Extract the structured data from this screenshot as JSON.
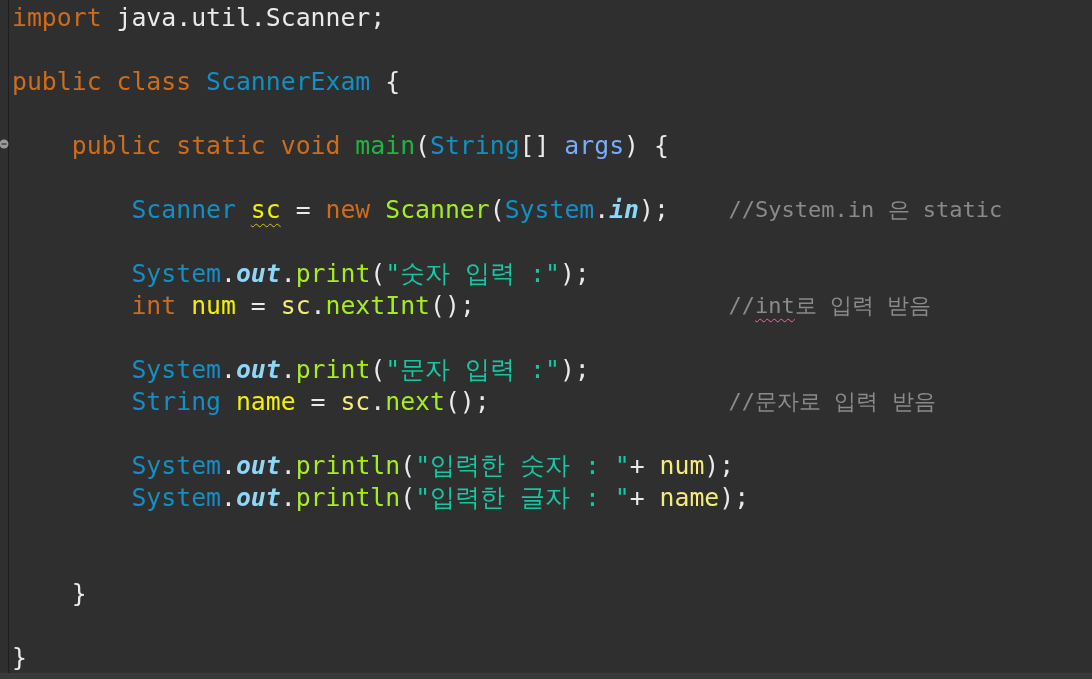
{
  "editor": {
    "lines": [
      {
        "kind": "code",
        "tokens": [
          {
            "text": "import",
            "kind": "keyword"
          },
          {
            "text": "java.util.Scanner;",
            "kind": "plain",
            "space_before": true
          }
        ]
      },
      {
        "kind": "blank"
      },
      {
        "kind": "code",
        "tokens": [
          {
            "text": "public",
            "kind": "keyword"
          },
          {
            "text": "class",
            "kind": "keyword",
            "space_before": true
          },
          {
            "text": "ScannerExam",
            "kind": "type",
            "space_before": true
          },
          {
            "text": "{",
            "kind": "plain",
            "space_before": true
          }
        ],
        "children": [
          {
            "kind": "blank"
          },
          {
            "kind": "code",
            "fold": true,
            "tokens": [
              {
                "text": "public",
                "kind": "keyword"
              },
              {
                "text": "static",
                "kind": "keyword",
                "space_before": true
              },
              {
                "text": "void",
                "kind": "keyword",
                "space_before": true
              },
              {
                "text": "main",
                "kind": "method-decl",
                "space_before": true
              },
              {
                "text": "(",
                "kind": "plain"
              },
              {
                "text": "String",
                "kind": "type"
              },
              {
                "text": "[]",
                "kind": "plain"
              },
              {
                "text": "args",
                "kind": "param",
                "space_before": true
              },
              {
                "text": ")",
                "kind": "plain"
              },
              {
                "text": "{",
                "kind": "plain",
                "space_before": true
              }
            ],
            "children": [
              {
                "kind": "blank"
              },
              {
                "kind": "code",
                "tokens": [
                  {
                    "text": "Scanner",
                    "kind": "type"
                  },
                  {
                    "text": "sc",
                    "kind": "local-decl",
                    "warning": true,
                    "space_before": true
                  },
                  {
                    "text": "=",
                    "kind": "plain",
                    "space_before": true
                  },
                  {
                    "text": "new",
                    "kind": "keyword",
                    "space_before": true
                  },
                  {
                    "text": "Scanner",
                    "kind": "method",
                    "space_before": true
                  },
                  {
                    "text": "(",
                    "kind": "plain"
                  },
                  {
                    "text": "System",
                    "kind": "type"
                  },
                  {
                    "text": ".",
                    "kind": "plain"
                  },
                  {
                    "text": "in",
                    "kind": "field"
                  },
                  {
                    "text": ");",
                    "kind": "plain"
                  }
                ],
                "comment": [
                  {
                    "text": "//System.in 은 static"
                  }
                ]
              },
              {
                "kind": "blank"
              },
              {
                "kind": "code",
                "tokens": [
                  {
                    "text": "System",
                    "kind": "type"
                  },
                  {
                    "text": ".",
                    "kind": "plain"
                  },
                  {
                    "text": "out",
                    "kind": "field"
                  },
                  {
                    "text": ".",
                    "kind": "plain"
                  },
                  {
                    "text": "print",
                    "kind": "method"
                  },
                  {
                    "text": "(",
                    "kind": "plain"
                  },
                  {
                    "text": "\"숫자 입력 :\"",
                    "kind": "string"
                  },
                  {
                    "text": ");",
                    "kind": "plain"
                  }
                ]
              },
              {
                "kind": "code",
                "tokens": [
                  {
                    "text": "int",
                    "kind": "keyword"
                  },
                  {
                    "text": "num",
                    "kind": "local-decl",
                    "space_before": true
                  },
                  {
                    "text": "=",
                    "kind": "plain",
                    "space_before": true
                  },
                  {
                    "text": "sc",
                    "kind": "local",
                    "space_before": true
                  },
                  {
                    "text": ".",
                    "kind": "plain"
                  },
                  {
                    "text": "nextInt",
                    "kind": "method"
                  },
                  {
                    "text": "();",
                    "kind": "plain"
                  }
                ],
                "comment": [
                  {
                    "text": "//"
                  },
                  {
                    "text": "int",
                    "misspelled": true
                  },
                  {
                    "text": "로 입력 받음"
                  }
                ]
              },
              {
                "kind": "blank"
              },
              {
                "kind": "code",
                "tokens": [
                  {
                    "text": "System",
                    "kind": "type"
                  },
                  {
                    "text": ".",
                    "kind": "plain"
                  },
                  {
                    "text": "out",
                    "kind": "field"
                  },
                  {
                    "text": ".",
                    "kind": "plain"
                  },
                  {
                    "text": "print",
                    "kind": "method"
                  },
                  {
                    "text": "(",
                    "kind": "plain"
                  },
                  {
                    "text": "\"문자 입력 :\"",
                    "kind": "string"
                  },
                  {
                    "text": ");",
                    "kind": "plain"
                  }
                ]
              },
              {
                "kind": "code",
                "tokens": [
                  {
                    "text": "String",
                    "kind": "type"
                  },
                  {
                    "text": "name",
                    "kind": "local-decl",
                    "space_before": true
                  },
                  {
                    "text": "=",
                    "kind": "plain",
                    "space_before": true
                  },
                  {
                    "text": "sc",
                    "kind": "local",
                    "space_before": true
                  },
                  {
                    "text": ".",
                    "kind": "plain"
                  },
                  {
                    "text": "next",
                    "kind": "method"
                  },
                  {
                    "text": "();",
                    "kind": "plain"
                  }
                ],
                "comment": [
                  {
                    "text": "//문자로 입력 받음"
                  }
                ]
              },
              {
                "kind": "blank"
              },
              {
                "kind": "code",
                "tokens": [
                  {
                    "text": "System",
                    "kind": "type"
                  },
                  {
                    "text": ".",
                    "kind": "plain"
                  },
                  {
                    "text": "out",
                    "kind": "field"
                  },
                  {
                    "text": ".",
                    "kind": "plain"
                  },
                  {
                    "text": "println",
                    "kind": "method"
                  },
                  {
                    "text": "(",
                    "kind": "plain"
                  },
                  {
                    "text": "\"입력한 숫자 : \"",
                    "kind": "string"
                  },
                  {
                    "text": "+",
                    "kind": "plain"
                  },
                  {
                    "text": "num",
                    "kind": "local",
                    "space_before": true
                  },
                  {
                    "text": ");",
                    "kind": "plain"
                  }
                ]
              },
              {
                "kind": "code",
                "tokens": [
                  {
                    "text": "System",
                    "kind": "type"
                  },
                  {
                    "text": ".",
                    "kind": "plain"
                  },
                  {
                    "text": "out",
                    "kind": "field"
                  },
                  {
                    "text": ".",
                    "kind": "plain"
                  },
                  {
                    "text": "println",
                    "kind": "method"
                  },
                  {
                    "text": "(",
                    "kind": "plain"
                  },
                  {
                    "text": "\"입력한 글자 : \"",
                    "kind": "string"
                  },
                  {
                    "text": "+",
                    "kind": "plain"
                  },
                  {
                    "text": "name",
                    "kind": "local",
                    "space_before": true
                  },
                  {
                    "text": ");",
                    "kind": "plain"
                  }
                ]
              },
              {
                "kind": "blank"
              },
              {
                "kind": "blank"
              }
            ]
          },
          {
            "kind": "code",
            "tokens": [
              {
                "text": "}",
                "kind": "plain"
              }
            ]
          },
          {
            "kind": "blank"
          }
        ]
      },
      {
        "kind": "code",
        "tokens": [
          {
            "text": "}",
            "kind": "plain"
          }
        ]
      }
    ]
  }
}
